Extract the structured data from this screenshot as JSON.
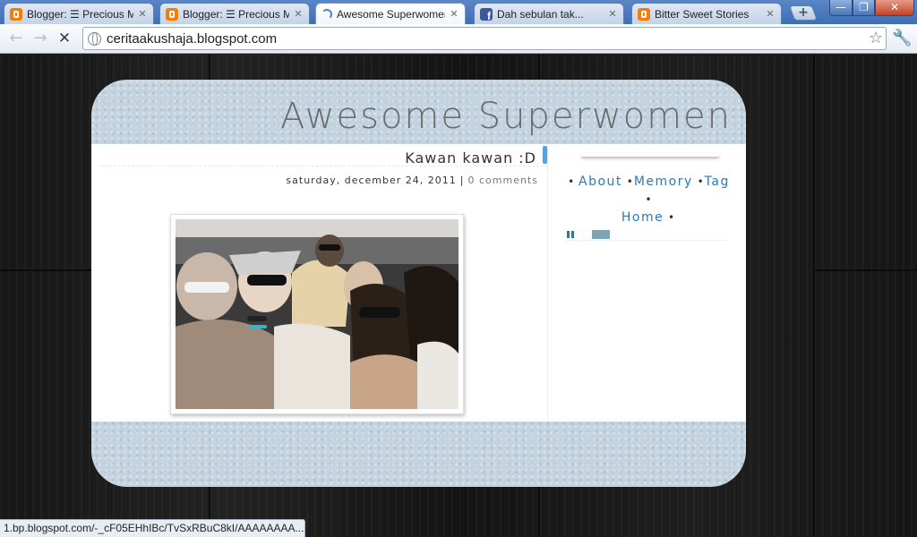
{
  "browser": {
    "tabs": [
      {
        "title": "Blogger: ☰ Precious Mem",
        "favicon": "blogger-icon",
        "close": "✕"
      },
      {
        "title": "Blogger: ☰ Precious Mem",
        "favicon": "blogger-icon",
        "close": "✕"
      },
      {
        "title": "Awesome Superwomen",
        "favicon": "loading-icon",
        "close": "✕"
      },
      {
        "title": "Dah sebulan tak...",
        "favicon": "facebook-icon",
        "close": "✕"
      },
      {
        "title": "Bitter Sweet Stories",
        "favicon": "blogger-icon",
        "close": "✕"
      }
    ],
    "new_tab": "+",
    "window_controls": {
      "minimize": "—",
      "maximize": "❐",
      "close": "✕"
    },
    "toolbar": {
      "back": "←",
      "forward": "→",
      "stop": "✕",
      "star": "☆",
      "wrench": "🔧"
    },
    "address": "ceritaakushaja.blogspot.com"
  },
  "blog": {
    "title": "Awesome Superwomen",
    "post": {
      "title": "Kawan kawan :D",
      "date": "saturday, december 24, 2011",
      "separator": "|",
      "comments": "0 comments"
    },
    "sidebar": {
      "nav": [
        {
          "label": "About"
        },
        {
          "label": "Memory"
        },
        {
          "label": "Tag"
        },
        {
          "label": "Home"
        }
      ],
      "bullet": "•"
    }
  },
  "status_bar": "1.bp.blogspot.com/-_cF05EHhIBc/TvSxRBuC8kI/AAAAAAAA..."
}
